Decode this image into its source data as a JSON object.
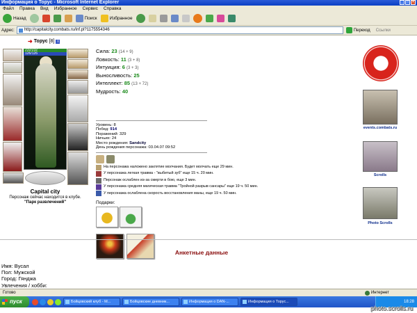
{
  "window": {
    "title": "Информация о Торус - Microsoft Internet Explorer"
  },
  "menu": [
    "Файл",
    "Правка",
    "Вид",
    "Избранное",
    "Сервис",
    "Справка"
  ],
  "toolbar": {
    "back": "Назад",
    "search": "Поиск",
    "favorites": "Избранное"
  },
  "address": {
    "label": "Адрес:",
    "url": "http://capitalcity.combats.ru/inf.pl?1175554346",
    "go": "Переход",
    "links": "Ссылки"
  },
  "character": {
    "name": "Торус",
    "level": "[8]",
    "hp": "232/232",
    "mp": "126/126",
    "city": "Capital city",
    "location_note": "Персонаж сейчас находится в клубе.",
    "club": "\"Парк развлечений\""
  },
  "stats": [
    {
      "label": "Сила:",
      "value": "23",
      "bonus": "(14 + 9)"
    },
    {
      "label": "Ловкость:",
      "value": "11",
      "bonus": "(3 + 8)"
    },
    {
      "label": "Интуиция:",
      "value": "6",
      "bonus": "(3 + 3)"
    },
    {
      "label": "Выносливость:",
      "value": "25",
      "bonus": ""
    },
    {
      "label": "Интеллект:",
      "value": "85",
      "bonus": "(13 + 72)"
    },
    {
      "label": "Мудрость:",
      "value": "40",
      "bonus": ""
    }
  ],
  "info": {
    "level": "Уровень: 8",
    "wins_label": "Побед:",
    "wins": "914",
    "losses": "Поражений: 329",
    "draws": "Ничьих: 24",
    "birthplace_label": "Место рождения:",
    "birthplace": "Sandcity",
    "birthday": "День рождения персонажа: 03.04.07 09:52"
  },
  "effects": [
    {
      "text": "На персонажа наложено заклятие молчания. Будет молчать еще 29 мин."
    },
    {
      "text": "У персонажа легкая травма - \"выбитый зуб\" еще 15 ч. 20 мин."
    },
    {
      "text": "Персонаж ослаблен из-за смерти в бою, еще 3 мин."
    },
    {
      "text": "У персонажа средняя магическая травма \"Тройной разрыв сансары\" еще 19 ч. 50 мин."
    },
    {
      "text": "У персонажа ослаблена скорость восстановления маны, еще 19 ч. 50 мин."
    }
  ],
  "gifts": {
    "label": "Подарки:"
  },
  "side": {
    "events": "events.combats.ru",
    "scrolls": "Scrolls",
    "photo": "Photo Scrolls"
  },
  "anket": {
    "title": "Анкетные данные",
    "name": "Имя: Вусал",
    "sex": "Пол: Мужской",
    "city": "Город: Гянджа",
    "hobby": "Увлечения / хобби:"
  },
  "status": {
    "left": "Готово",
    "zone": "Интернет"
  },
  "taskbar": {
    "start": "пуск",
    "tasks": [
      "Бойцовский клуб - M...",
      "Бойцовские дневник...",
      "Информация о DAN-...",
      "Информация о Торус..."
    ],
    "clock": "18:28"
  },
  "watermark": "photo.scrolls.ru",
  "colors": {
    "accent_green": "#1b8a1b",
    "anket_red": "#8a0f0f",
    "xp_blue": "#1f55c8"
  }
}
